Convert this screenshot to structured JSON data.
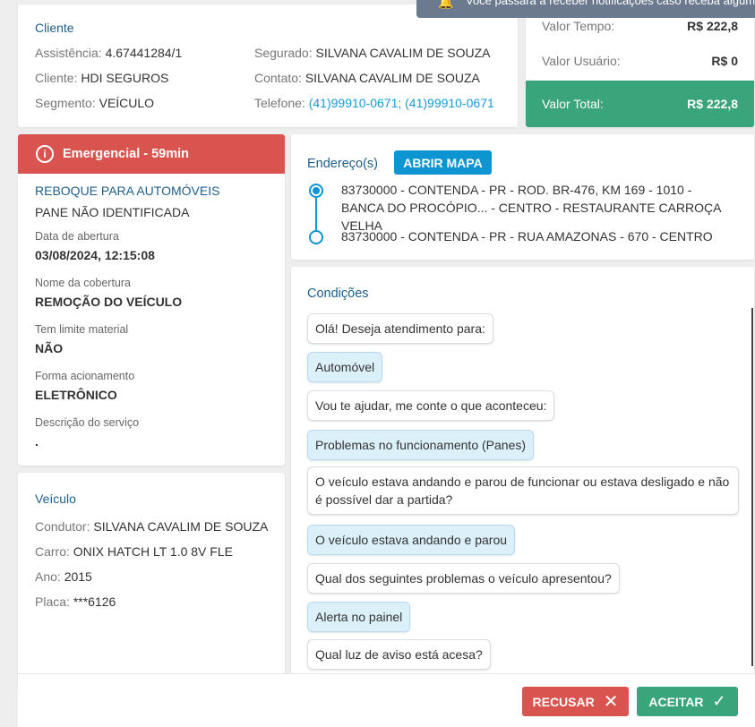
{
  "notification": {
    "icon": "bell-icon",
    "text": "Você passará a receber notificações caso receba algum serviço"
  },
  "cliente": {
    "title": "Cliente",
    "assistencia_label": "Assistência:",
    "assistencia": "4.67441284/1",
    "cliente_label": "Cliente:",
    "cliente": "HDI SEGUROS",
    "segmento_label": "Segmento:",
    "segmento": "VEÍCULO",
    "segurado_label": "Segurado:",
    "segurado": "SILVANA CAVALIM DE SOUZA",
    "contato_label": "Contato:",
    "contato": "SILVANA CAVALIM DE SOUZA",
    "telefone_label": "Telefone:",
    "telefone": "(41)99910-0671; (41)99910-0671"
  },
  "valores": {
    "tempo_label": "Valor Tempo:",
    "tempo": "R$ 222,8",
    "usuario_label": "Valor Usuário:",
    "usuario": "R$ 0",
    "total_label": "Valor Total:",
    "total": "R$ 222,8",
    "total_color": "#3aa57a"
  },
  "servico": {
    "badge": "Emergencial - 59min",
    "badge_color": "#d9534f",
    "tipo": "REBOQUE PARA AUTOMÓVEIS",
    "problema": "PANE NÃO IDENTIFICADA",
    "fields": [
      {
        "label": "Data de abertura",
        "value": "03/08/2024, 12:15:08"
      },
      {
        "label": "Nome da cobertura",
        "value": "REMOÇÃO DO VEÍCULO"
      },
      {
        "label": "Tem limite material",
        "value": "NÃO"
      },
      {
        "label": "Forma acionamento",
        "value": "ELETRÔNICO"
      },
      {
        "label": "Descrição do serviço",
        "value": "."
      }
    ]
  },
  "veiculo": {
    "title": "Veículo",
    "condutor_label": "Condutor:",
    "condutor": "SILVANA CAVALIM DE SOUZA",
    "carro_label": "Carro:",
    "carro": "ONIX HATCH LT 1.0 8V FLE",
    "ano_label": "Ano:",
    "ano": "2015",
    "placa_label": "Placa:",
    "placa": "***6126"
  },
  "enderecos": {
    "title": "Endereço(s)",
    "map_button": "ABRIR MAPA",
    "items": [
      "83730000 - CONTENDA - PR - ROD. BR-476, KM 169 - 1010 - BANCA DO PROCÓPIO... - CENTRO - RESTAURANTE CARROÇA VELHA",
      "83730000 - CONTENDA - PR - RUA AMAZONAS - 670 - CENTRO"
    ]
  },
  "condicoes": {
    "title": "Condições",
    "messages": [
      {
        "text": "Olá! Deseja atendimento para:",
        "answer": false
      },
      {
        "text": "Automóvel",
        "answer": true
      },
      {
        "text": "Vou te ajudar, me conte o que aconteceu:",
        "answer": false
      },
      {
        "text": "Problemas no funcionamento (Panes)",
        "answer": true
      },
      {
        "text": "O veículo estava andando e parou de funcionar ou estava desligado e não é possível dar a partida?",
        "answer": false
      },
      {
        "text": "O veículo estava andando e parou",
        "answer": true
      },
      {
        "text": "Qual dos seguintes problemas o veículo apresentou?",
        "answer": false
      },
      {
        "text": "Alerta no painel",
        "answer": true
      },
      {
        "text": "Qual luz de aviso está acesa?",
        "answer": false
      }
    ]
  },
  "footer": {
    "recusar": "RECUSAR",
    "aceitar": "ACEITAR",
    "recusar_color": "#d9534f",
    "aceitar_color": "#3aa57a"
  }
}
